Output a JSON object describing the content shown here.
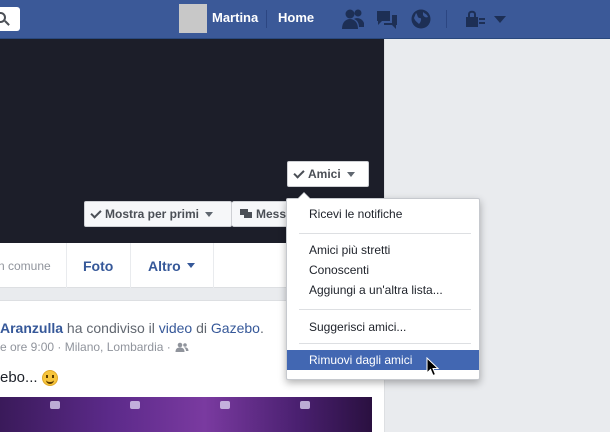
{
  "topbar": {
    "user_name": "Martina",
    "home_label": "Home",
    "icons": [
      "search-icon",
      "friend-requests-icon",
      "messages-icon",
      "notifications-globe-icon",
      "privacy-lock-icon",
      "account-menu-caret-icon"
    ]
  },
  "cover": {
    "friends_button_label": "Amici",
    "see_first_button_label": "Mostra per primi",
    "message_button_label": "Mess"
  },
  "tabs": {
    "common_label": "n comune",
    "photos_label": "Foto",
    "more_label": "Altro"
  },
  "post": {
    "author": "Aranzulla",
    "shared_text": " ha condiviso il ",
    "object_link": "video",
    "of_text": " di ",
    "page_link": "Gazebo",
    "period": ".",
    "meta": "e ore 9:00 · Milano, Lombardia ·",
    "text": "ebo..."
  },
  "friends_menu": {
    "items": [
      {
        "label": "Ricevi le notifiche"
      },
      {
        "label": "Amici più stretti"
      },
      {
        "label": "Conoscenti"
      },
      {
        "label": "Aggiungi a un'altra lista..."
      },
      {
        "label": "Suggerisci amici..."
      },
      {
        "label": "Rimuovi dagli amici",
        "highlighted": true
      }
    ]
  },
  "colors": {
    "brand_blue": "#3b5998",
    "menu_highlight": "#4267b2",
    "link": "#365899",
    "cover_dark": "#1c1e29"
  }
}
